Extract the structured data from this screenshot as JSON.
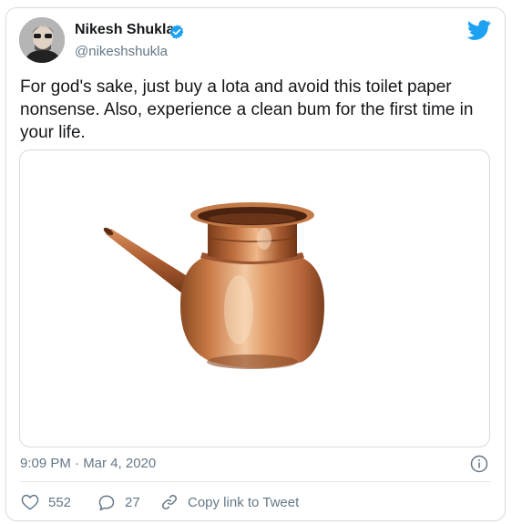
{
  "user": {
    "display_name": "Nikesh Shukla",
    "handle": "@nikeshshukla"
  },
  "tweet": {
    "text": "For god's sake, just buy a lota and avoid this toilet paper nonsense. Also, experience a clean bum for the first time in your life.",
    "timestamp": "9:09 PM · Mar 4, 2020"
  },
  "media": {
    "subject": "copper-lota-image"
  },
  "actions": {
    "likes": "552",
    "replies": "27",
    "copy_link": "Copy link to Tweet"
  },
  "icons": {
    "brand": "twitter-bird-icon",
    "verified": "verified-badge-icon",
    "info": "info-icon",
    "like": "heart-icon",
    "reply": "reply-bubble-icon",
    "link": "link-icon"
  },
  "colors": {
    "twitter_blue": "#1da1f2",
    "secondary_text": "#657786",
    "primary_text": "#14171a",
    "border": "#d6dbdf"
  }
}
